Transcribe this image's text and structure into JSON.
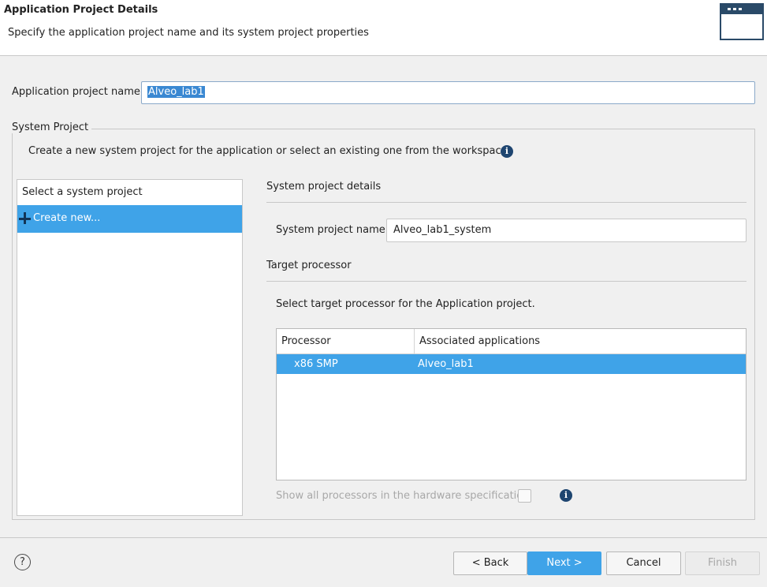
{
  "header": {
    "title": "Application Project Details",
    "subtitle": "Specify the application project name and its system project properties",
    "icon": "window-icon"
  },
  "app_project": {
    "label": "Application project name:",
    "value": "Alveo_lab1"
  },
  "system_project": {
    "group_label": "System Project",
    "description": "Create a new system project for the application or select an existing one from the workspace",
    "info_icon": "i",
    "list": {
      "header": "Select a system project",
      "items": [
        {
          "label": "Create new...",
          "icon": "plus-icon",
          "selected": true
        }
      ]
    },
    "details": {
      "heading": "System project details",
      "name_label": "System project name:",
      "name_value": "Alveo_lab1_system"
    },
    "target": {
      "heading": "Target processor",
      "description": "Select target processor for the Application project.",
      "table": {
        "columns": [
          "Processor",
          "Associated applications"
        ],
        "rows": [
          {
            "processor": "x86 SMP",
            "applications": "Alveo_lab1",
            "selected": true
          }
        ]
      },
      "show_all_label": "Show all processors in the hardware specification",
      "show_all_checked": false,
      "show_all_info_icon": "i"
    }
  },
  "footer": {
    "help_icon": "?",
    "buttons": {
      "back": "< Back",
      "next": "Next >",
      "cancel": "Cancel",
      "finish": "Finish"
    }
  },
  "colors": {
    "selection": "#3fa3e8",
    "accent_dark": "#1e4570"
  }
}
